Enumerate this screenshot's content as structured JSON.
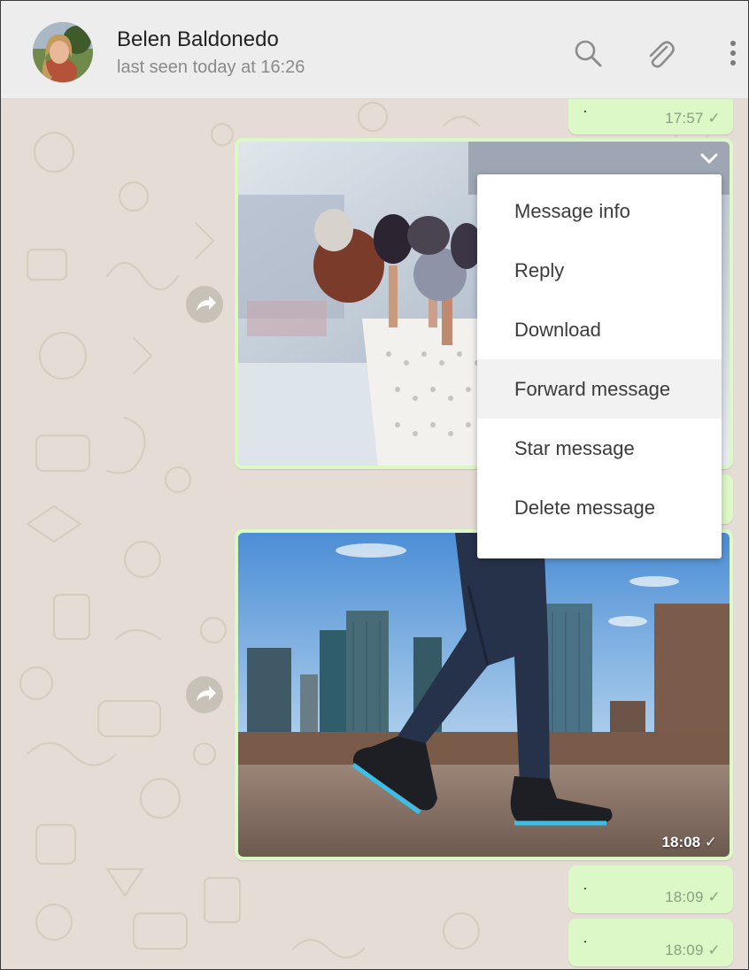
{
  "header": {
    "contact_name": "Belen Baldonedo",
    "status": "last seen today at 16:26",
    "icons": [
      "search-icon",
      "attach-icon",
      "menu-icon"
    ],
    "background_color": "#ededed"
  },
  "messages": {
    "top": {
      "text": "·",
      "time": "17:57 ✓"
    },
    "image1": {
      "description_icon": "photo",
      "time": ""
    },
    "image2": {
      "time": "18:08 ✓"
    },
    "bottom1": {
      "text": "·",
      "time": "18:09 ✓"
    },
    "bottom2": {
      "text": "·",
      "time": "18:09 ✓"
    }
  },
  "context_menu": {
    "items": [
      "Message info",
      "Reply",
      "Download",
      "Forward message",
      "Star message",
      "Delete message"
    ],
    "highlighted_index": 3
  },
  "colors": {
    "outgoing_bubble": "#dcf8c6",
    "chat_background": "#e5ddd5",
    "menu_highlight": "#f2f2f2"
  }
}
